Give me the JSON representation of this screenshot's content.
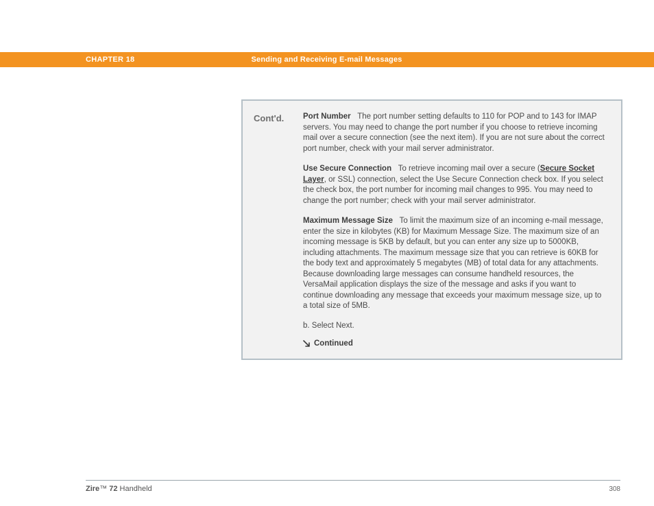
{
  "header": {
    "chapter_label": "CHAPTER 18",
    "chapter_title": "Sending and Receiving E-mail Messages"
  },
  "box": {
    "contd": "Cont'd.",
    "entries": [
      {
        "title": "Port Number",
        "body": "The port number setting defaults to 110 for POP and to 143 for IMAP servers. You may need to change the port number if you choose to retrieve incoming mail over a secure connection (see the next item). If you are not sure about the correct port number, check with your mail server administrator."
      },
      {
        "title": "Use Secure Connection",
        "body_pre": "To retrieve incoming mail over a secure (",
        "link": "Secure Socket Layer",
        "body_post": ", or SSL) connection, select the Use Secure Connection check box. If you select the check box, the port number for incoming mail changes to 995. You may need to change the port number; check with your mail server administrator."
      },
      {
        "title": "Maximum Message Size",
        "body": "To limit the maximum size of an incoming e-mail message, enter the size in kilobytes (KB) for Maximum Message Size. The maximum size of an incoming message is 5KB by default, but you can enter any size up to 5000KB, including attachments. The maximum message size that you can retrieve is 60KB for the body text and approximately 5 megabytes (MB) of total data for any attachments. Because downloading large messages can consume handheld resources, the VersaMail application displays the size of the message and asks if you want to continue downloading any message that exceeds your maximum message size, up to a total size of 5MB."
      }
    ],
    "step": "b.  Select Next.",
    "continued": "Continued"
  },
  "footer": {
    "brand": "Zire",
    "tm": "™",
    "model": " 72",
    "suffix": " Handheld",
    "page": "308"
  }
}
